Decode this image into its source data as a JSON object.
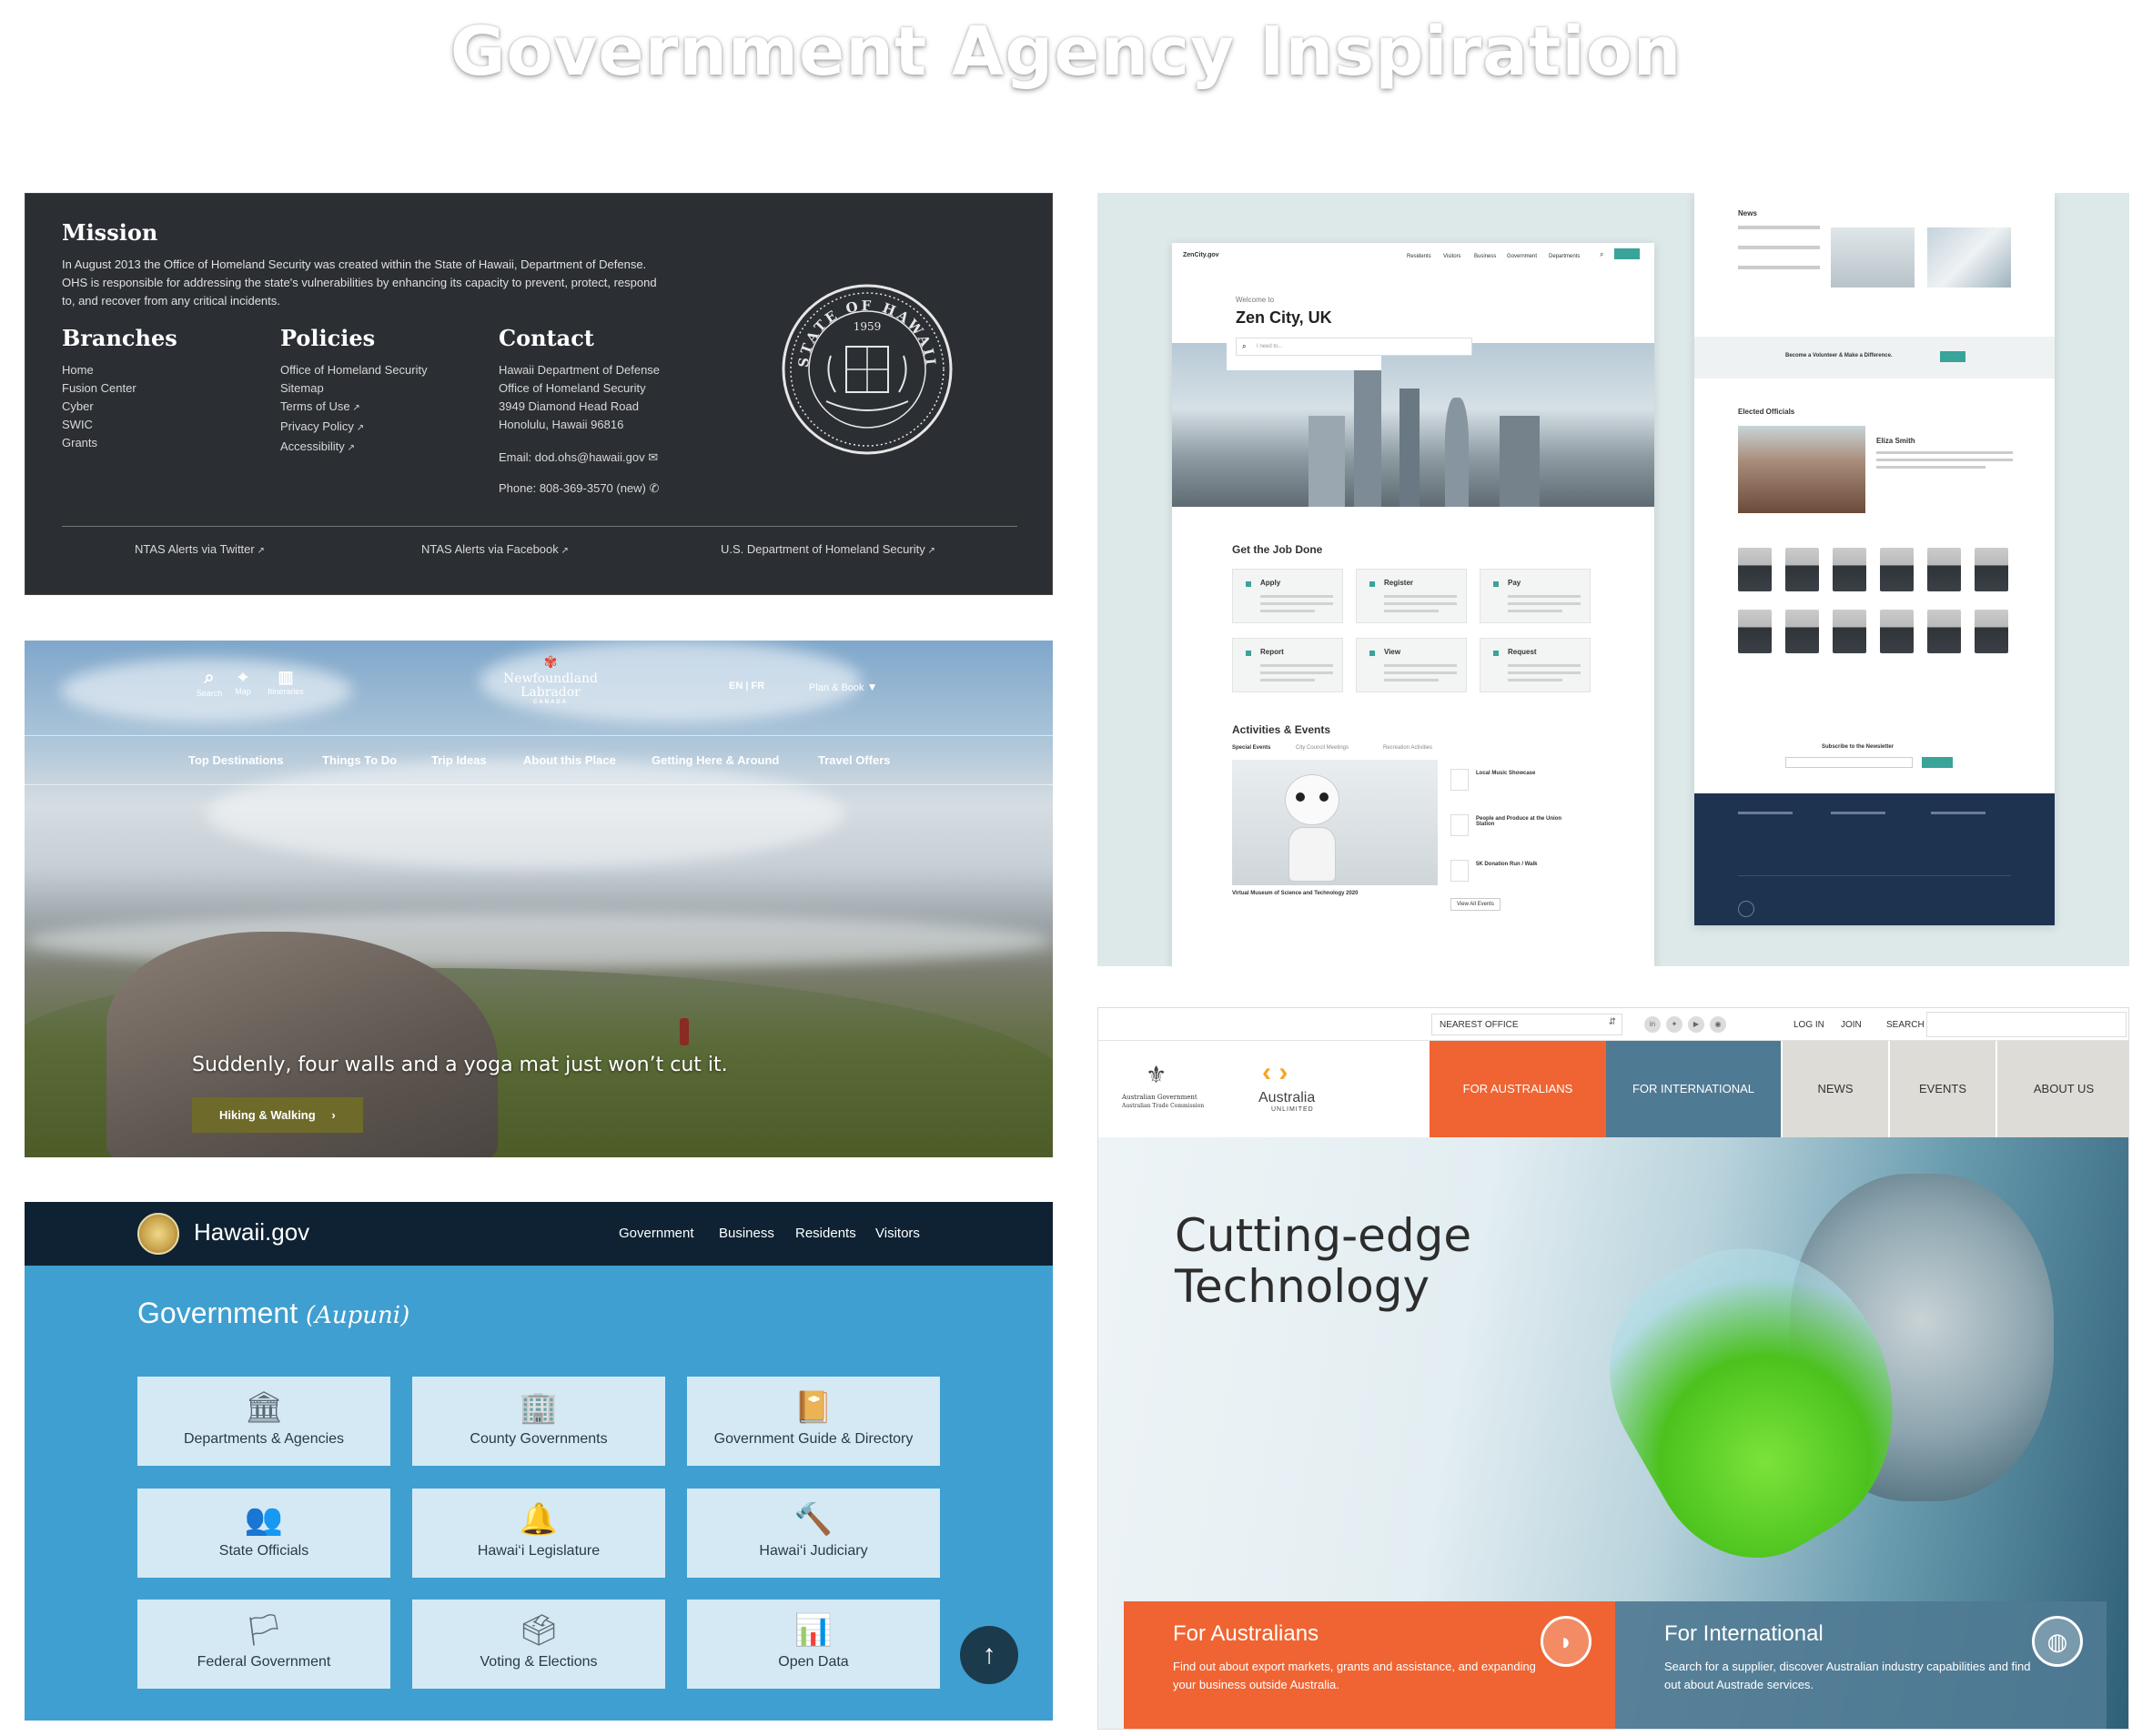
{
  "title": "Government Agency Inspiration",
  "ohs": {
    "mission_title": "Mission",
    "mission_text_1": "In August 2013 the Office of Homeland Security was created within the State of Hawaii, Department of Defense.",
    "mission_text_2": "OHS is responsible for addressing the state's vulnerabilities by enhancing its capacity to prevent, protect, respond",
    "mission_text_3": "to, and recover from any critical incidents.",
    "branches_title": "Branches",
    "branches": [
      "Home",
      "Fusion Center",
      "Cyber",
      "SWIC",
      "Grants"
    ],
    "policies_title": "Policies",
    "policies": [
      "Office of Homeland Security",
      "Sitemap",
      "Terms of Use",
      "Privacy Policy",
      "Accessibility"
    ],
    "contact_title": "Contact",
    "contact_lines": [
      "Hawaii Department of Defense",
      "Office of Homeland Security",
      "3949 Diamond Head Road",
      "Honolulu, Hawaii 96816"
    ],
    "email": "Email: dod.ohs@hawaii.gov",
    "phone": "Phone: 808-369-3570 (new)",
    "footer_links": [
      "NTAS Alerts via Twitter",
      "NTAS Alerts via Facebook",
      "U.S. Department of Homeland Security"
    ],
    "seal_text": "STATE OF HAWAII",
    "seal_year": "1959"
  },
  "nl": {
    "icons": [
      "Search",
      "Map",
      "Itineraries"
    ],
    "logo": "Newfoundland Labrador",
    "logo_sub": "CANADA",
    "lang": "EN | FR",
    "plan": "Plan & Book",
    "nav": [
      "Top Destinations",
      "Things To Do",
      "Trip Ideas",
      "About this Place",
      "Getting Here & Around",
      "Travel Offers"
    ],
    "tagline": "Suddenly, four walls and a yoga mat just won’t cut it.",
    "button": "Hiking & Walking"
  },
  "hg": {
    "logo": "Hawaii.gov",
    "nav": [
      "Government",
      "Business",
      "Residents",
      "Visitors"
    ],
    "heading": "Government",
    "heading_sub": "(Aupuni)",
    "tiles": [
      {
        "label": "Departments & Agencies",
        "icon": "🏛"
      },
      {
        "label": "County Governments",
        "icon": "🏢"
      },
      {
        "label": "Government Guide & Directory",
        "icon": "📔"
      },
      {
        "label": "State Officials",
        "icon": "👥"
      },
      {
        "label": "Hawai‘i Legislature",
        "icon": "🔔"
      },
      {
        "label": "Hawai‘i Judiciary",
        "icon": "🔨"
      },
      {
        "label": "Federal Government",
        "icon": "🏳"
      },
      {
        "label": "Voting & Elections",
        "icon": "🗳"
      },
      {
        "label": "Open Data",
        "icon": "📊"
      }
    ],
    "up_icon": "↑"
  },
  "zen": {
    "brand": "ZenCity.gov",
    "nav": [
      "Residents",
      "Visitors",
      "Business",
      "Government",
      "Departments"
    ],
    "welcome": "Welcome to",
    "city": "Zen City, UK",
    "search_placeholder": "I need to...",
    "job_title": "Get the Job Done",
    "jobs": [
      "Apply",
      "Register",
      "Pay",
      "Report",
      "View",
      "Request"
    ],
    "activities_title": "Activities & Events",
    "activity_tabs": [
      "Special Events",
      "City Council Meetings",
      "Recreation Activities"
    ],
    "events": [
      "Local Music Showcase",
      "People and Produce at the Union Station",
      "5K Donation Run / Walk"
    ],
    "event_caption": "Virtual Museum of Science and Technology 2020",
    "view_all": "View All Events",
    "news_title": "News",
    "volunteer": "Become a Volunteer & Make a Difference.",
    "officials_title": "Elected Officials",
    "official_name": "Eliza Smith",
    "subscribe": "Subscribe to the Newsletter"
  },
  "au": {
    "nearest": "NEAREST OFFICE",
    "top_links": [
      "LOG IN",
      "JOIN",
      "SEARCH"
    ],
    "logo_gov": "Australian Government",
    "logo_gov_sub": "Australian Trade Commission",
    "logo_brand": "Australia",
    "logo_brand_sub": "UNLIMITED",
    "nav": [
      "FOR AUSTRALIANS",
      "FOR INTERNATIONAL",
      "NEWS",
      "EVENTS",
      "ABOUT US"
    ],
    "headline_1": "Cutting-edge",
    "headline_2": "Technology",
    "card1_title": "For Australians",
    "card1_text": "Find out about export markets, grants and assistance, and expanding your business outside Australia.",
    "card2_title": "For International",
    "card2_text": "Search for a supplier, discover Australian industry capabilities and find out about Austrade services.",
    "colors": {
      "orange": "#ef6432",
      "steel": "#4f7a93",
      "grey": "#dedcd6"
    }
  }
}
